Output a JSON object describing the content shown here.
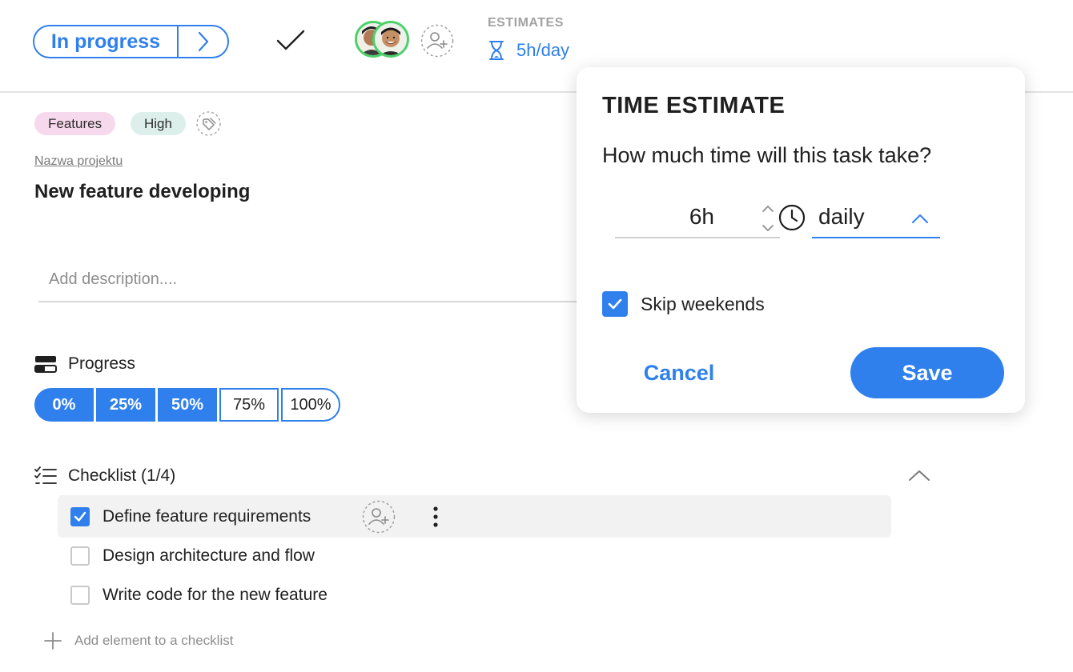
{
  "header": {
    "status_label": "In progress",
    "estimates_label": "ESTIMATES",
    "estimate_value": "5h/day"
  },
  "tags": [
    {
      "label": "Features",
      "color": "#f6d9ec"
    },
    {
      "label": "High",
      "color": "#dcefea"
    }
  ],
  "task": {
    "project_label": "Nazwa projektu",
    "title": "New feature developing",
    "description_placeholder": "Add description...."
  },
  "progress": {
    "label": "Progress",
    "options": [
      "0%",
      "25%",
      "50%",
      "75%",
      "100%"
    ],
    "selected": "50%"
  },
  "checklist": {
    "label": "Checklist (1/4)",
    "items": [
      {
        "text": "Define feature requirements",
        "checked": true
      },
      {
        "text": "Design architecture and flow",
        "checked": false
      },
      {
        "text": "Write code for the new feature",
        "checked": false
      }
    ],
    "add_label": "Add element to a checklist"
  },
  "popover": {
    "title": "TIME ESTIMATE",
    "question": "How much time will this task take?",
    "hours": "6h",
    "period": "daily",
    "skip_weekends_label": "Skip weekends",
    "skip_weekends": true,
    "cancel_label": "Cancel",
    "save_label": "Save"
  },
  "colors": {
    "accent": "#2f80ed",
    "avatar_ring": "#4cd16a"
  }
}
